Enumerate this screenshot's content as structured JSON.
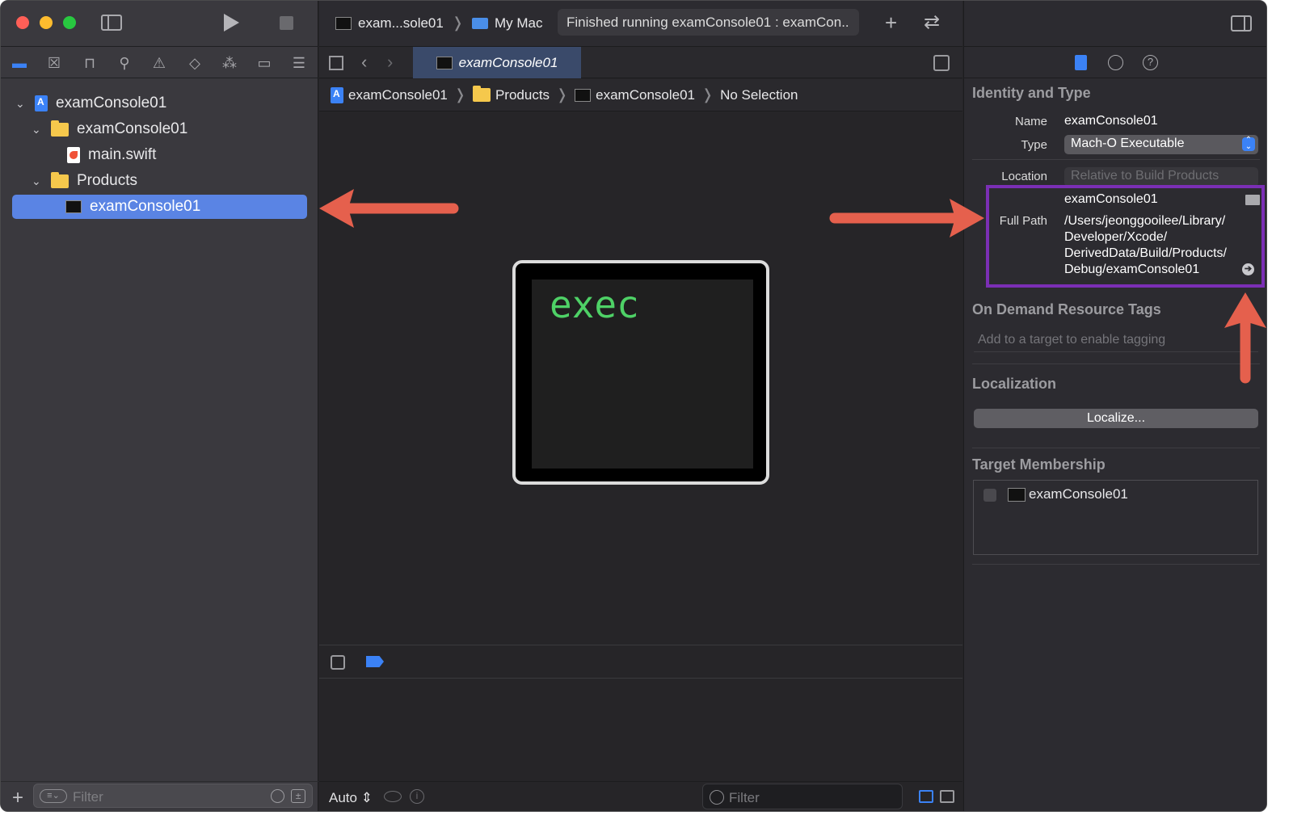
{
  "window": {
    "scheme": {
      "target": "exam...sole01",
      "destination": "My Mac"
    },
    "status": "Finished running examConsole01 : examCon..",
    "accent": "#5a84e4"
  },
  "navigator": {
    "tree": [
      {
        "label": "examConsole01",
        "kind": "project",
        "expanded": true
      },
      {
        "label": "examConsole01",
        "kind": "folder",
        "expanded": true
      },
      {
        "label": "main.swift",
        "kind": "swift-file"
      },
      {
        "label": "Products",
        "kind": "folder",
        "expanded": true
      },
      {
        "label": "examConsole01",
        "kind": "executable",
        "selected": true
      }
    ],
    "filter_placeholder": "Filter"
  },
  "editor": {
    "tab_label": "examConsole01",
    "breadcrumb": [
      "examConsole01",
      "Products",
      "examConsole01",
      "No Selection"
    ],
    "preview_text": "exec",
    "bottom": {
      "mode": "Auto",
      "filter_placeholder": "Filter"
    }
  },
  "inspector": {
    "identity": {
      "title": "Identity and Type",
      "name_label": "Name",
      "name_value": "examConsole01",
      "type_label": "Type",
      "type_value": "Mach-O Executable",
      "location_label": "Location",
      "location_value": "Relative to Build Products",
      "file_name": "examConsole01",
      "full_path_label": "Full Path",
      "full_path_lines": [
        "/Users/jeonggooilee/Library/",
        "Developer/Xcode/",
        "DerivedData/Build/Products/",
        "Debug/examConsole01"
      ]
    },
    "tags": {
      "title": "On Demand Resource Tags",
      "placeholder": "Add to a target to enable tagging"
    },
    "localization": {
      "title": "Localization",
      "button": "Localize..."
    },
    "membership": {
      "title": "Target Membership",
      "target": "examConsole01"
    }
  },
  "annotations": {
    "arrow_color": "#e5604d",
    "box_color": "#7b2fb5"
  }
}
